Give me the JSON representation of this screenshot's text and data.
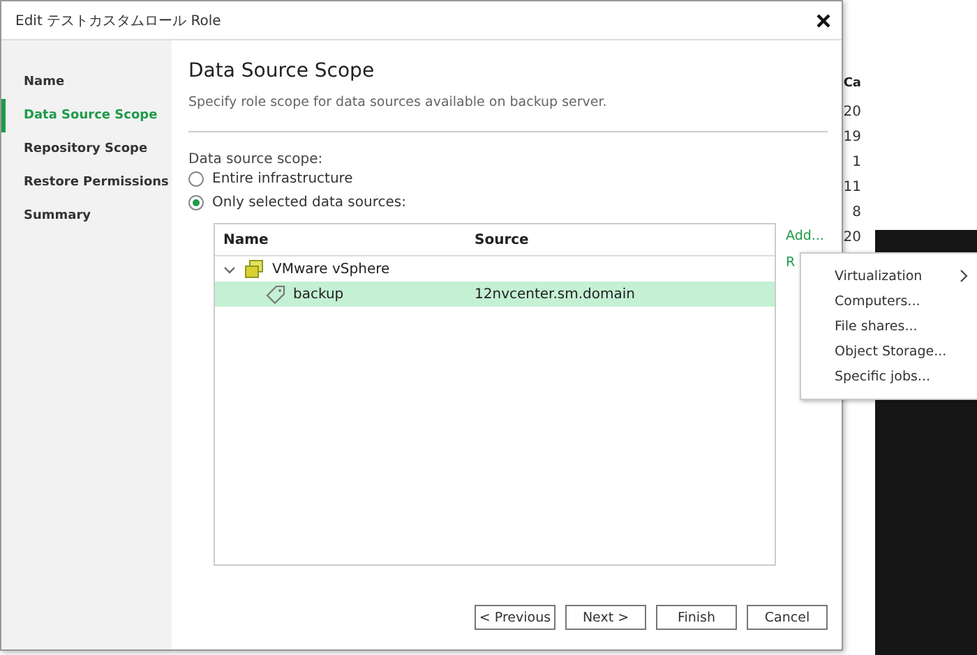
{
  "background_window": {
    "column_header": "Ca",
    "cells": [
      "20",
      "19",
      "1",
      "11",
      "8",
      "20"
    ]
  },
  "dialog": {
    "title": "Edit テストカスタムロール Role"
  },
  "steps": [
    {
      "label": "Name",
      "selected": false
    },
    {
      "label": "Data Source Scope",
      "selected": true
    },
    {
      "label": "Repository Scope",
      "selected": false
    },
    {
      "label": "Restore Permissions",
      "selected": false
    },
    {
      "label": "Summary",
      "selected": false
    }
  ],
  "page": {
    "heading": "Data Source Scope",
    "description": "Specify role scope for data sources available on backup server.",
    "scope_label": "Data source scope:",
    "options": [
      {
        "label": "Entire infrastructure",
        "selected": false
      },
      {
        "label": "Only selected data sources:",
        "selected": true
      }
    ]
  },
  "table": {
    "columns": [
      "Name",
      "Source"
    ],
    "rows": [
      {
        "name": "VMware vSphere",
        "kind": "platform",
        "expanded": true,
        "selected": false,
        "children": [
          {
            "name": "backup",
            "source": "12nvcenter.sm.domain",
            "kind": "tag",
            "selected": true
          }
        ]
      }
    ]
  },
  "side_links": [
    "Add...",
    "R"
  ],
  "context_menu": [
    {
      "label": "Virtualization",
      "submenu": true
    },
    {
      "label": "Computers...",
      "submenu": false
    },
    {
      "label": "File shares...",
      "submenu": false
    },
    {
      "label": "Object Storage...",
      "submenu": false
    },
    {
      "label": "Specific jobs...",
      "submenu": false
    }
  ],
  "buttons": [
    "< Previous",
    "Next >",
    "Finish",
    "Cancel"
  ]
}
